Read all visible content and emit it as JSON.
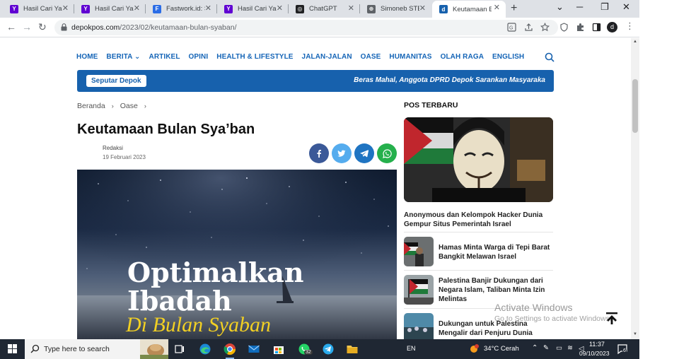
{
  "browser": {
    "tabs": [
      {
        "title": "Hasil Cari Yahoo",
        "favicon_color": "#6001d2",
        "favicon_glyph": "Y"
      },
      {
        "title": "Hasil Cari Yahoo",
        "favicon_color": "#6001d2",
        "favicon_glyph": "Y"
      },
      {
        "title": "Fastwork.id: Sewa",
        "favicon_color": "#2b6de6",
        "favicon_glyph": "F"
      },
      {
        "title": "Hasil Cari Yahoo",
        "favicon_color": "#6001d2",
        "favicon_glyph": "Y"
      },
      {
        "title": "ChatGPT",
        "favicon_color": "#202123",
        "favicon_glyph": "◎"
      },
      {
        "title": "Simoneb STEM",
        "favicon_color": "#5f6368",
        "favicon_glyph": "⊕"
      },
      {
        "title": "Keutamaan Bulan Sya'ban",
        "favicon_color": "#1761ad",
        "favicon_glyph": "d"
      }
    ],
    "url_host": "depokpos.com",
    "url_path": "/2023/02/keutamaan-bulan-syaban/",
    "new_tab": "+",
    "win_controls": [
      "⌄",
      "─",
      "❐",
      "✕"
    ],
    "profile_initial": "d"
  },
  "site": {
    "nav": [
      "HOME",
      "BERITA",
      "ARTIKEL",
      "OPINI",
      "HEALTH & LIFESTYLE",
      "JALAN-JALAN",
      "OASE",
      "HUMANITAS",
      "OLAH RAGA",
      "ENGLISH"
    ],
    "nav_dropdown_marker": "⌄",
    "ticker": {
      "badge": "Seputar Depok",
      "headline": "Beras Mahal, Anggota DPRD Depok Sarankan Masyaraka"
    },
    "breadcrumb": [
      "Beranda",
      "Oase"
    ],
    "article": {
      "title": "Keutamaan Bulan Sya’ban",
      "author": "Redaksi",
      "date": "19 Februari 2023",
      "hero_line1": "Optimalkan",
      "hero_line2": "Ibadah",
      "hero_line3": "Di Bulan Syaban"
    },
    "share": [
      {
        "name": "facebook",
        "color": "#3b5998",
        "glyph": "f"
      },
      {
        "name": "twitter",
        "color": "#55acee",
        "glyph": "t"
      },
      {
        "name": "telegram",
        "color": "#1f74c2",
        "glyph": "➤"
      },
      {
        "name": "whatsapp",
        "color": "#25b04c",
        "glyph": "✆"
      }
    ],
    "sidebar": {
      "title": "POS TERBARU",
      "featured": "Anonymous dan Kelompok Hacker Dunia Gempur Situs Pemerintah Israel",
      "items": [
        "Hamas Minta Warga di Tepi Barat Bangkit Melawan Israel",
        "Palestina Banjir Dukungan dari Negara Islam, Taliban Minta Izin Melintas",
        "Dukungan untuk Palestina Mengalir dari Penjuru Dunia"
      ]
    },
    "watermark": {
      "line1": "Activate Windows",
      "line2": "Go to Settings to activate Windows."
    }
  },
  "taskbar": {
    "search_placeholder": "Type here to search",
    "language": "EN",
    "weather": "34°C  Cerah",
    "time": "11:37",
    "date": "09/10/2023",
    "whatsapp_badge": "32",
    "notification_count": "6",
    "weather_badge": "1"
  }
}
